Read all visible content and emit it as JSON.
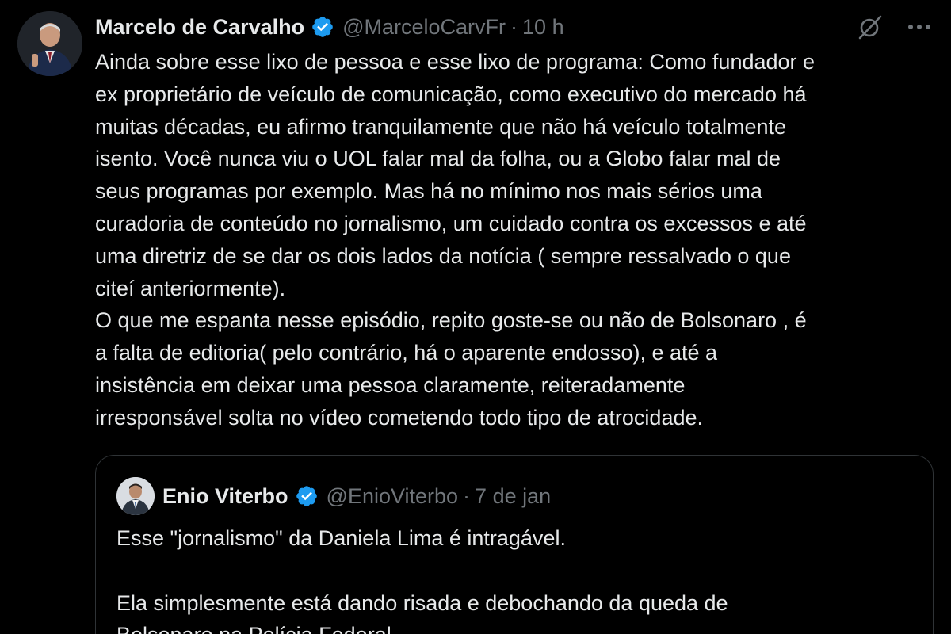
{
  "tweet": {
    "author_name": "Marcelo de Carvalho",
    "handle": "@MarceloCarvFr",
    "separator": "·",
    "time": "10 h",
    "text": "Ainda sobre esse lixo de pessoa e esse lixo de programa: Como fundador e\nex proprietário de veículo de comunicação, como executivo do mercado há\nmuitas décadas, eu afirmo tranquilamente que não há veículo totalmente\nisento. Você nunca viu o UOL falar mal da folha, ou a Globo falar mal de\nseus programas por exemplo. Mas há no mínimo nos mais sérios uma\ncuradoria de conteúdo no jornalismo, um cuidado contra os excessos e até\numa diretriz de se dar os dois lados da notícia ( sempre ressalvado o que\nciteí anteriormente).\nO que me espanta nesse episódio, repito goste-se ou não de Bolsonaro , é\na falta de editoria( pelo contrário, há o aparente endosso), e até a\ninsistência em deixar uma pessoa claramente, reiteradamente\nirresponsável solta no vídeo cometendo todo tipo de atrocidade.",
    "icons": {
      "verified": "verified-badge-icon",
      "grok": "grok-icon",
      "more": "more-icon"
    }
  },
  "quoted": {
    "author_name": "Enio Viterbo",
    "handle": "@EnioViterbo",
    "separator": "·",
    "time": "7 de jan",
    "text": "Esse \"jornalismo\" da Daniela Lima é intragável.\n\nEla simplesmente está dando risada e debochando da queda de\nBolsonaro na Polícia Federal"
  },
  "colors": {
    "background": "#000000",
    "text_primary": "#e7e9ea",
    "text_secondary": "#71767b",
    "verified_blue": "#1d9bf0",
    "border": "#2f3336"
  }
}
